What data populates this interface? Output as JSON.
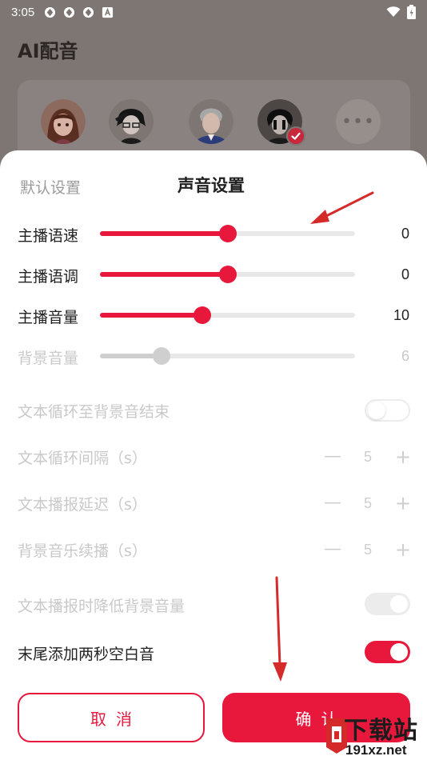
{
  "status_bar": {
    "time": "3:05",
    "notification_icons": [
      "app-icon",
      "app-icon",
      "app-icon",
      "a-icon"
    ]
  },
  "background": {
    "title": "AI配音"
  },
  "sheet": {
    "default_tab": "默认设置",
    "title": "声音设置",
    "sliders": [
      {
        "label": "主播语速",
        "value": "0",
        "level": 0.5,
        "enabled": true
      },
      {
        "label": "主播语调",
        "value": "0",
        "level": 0.5,
        "enabled": true
      },
      {
        "label": "主播音量",
        "value": "10",
        "level": 0.4,
        "enabled": true
      },
      {
        "label": "背景音量",
        "value": "6",
        "level": 0.24,
        "enabled": false
      }
    ],
    "loop_to_bg_end": {
      "label": "文本循环至背景音结束",
      "state": "off",
      "enabled": false
    },
    "steppers": [
      {
        "label": "文本循环间隔（s）",
        "value": "5",
        "minus": "—",
        "plus": "+"
      },
      {
        "label": "文本播报延迟（s）",
        "value": "5",
        "minus": "—",
        "plus": "+"
      },
      {
        "label": "背景音乐续播（s）",
        "value": "5",
        "minus": "—",
        "plus": "+"
      }
    ],
    "lower_bg_volume": {
      "label": "文本播报时降低背景音量",
      "state": "on",
      "enabled": false
    },
    "add_silence": {
      "label": "末尾添加两秒空白音",
      "state": "on",
      "enabled": true
    },
    "cancel_label": "取消",
    "confirm_label": "确认"
  },
  "watermark": {
    "top": "下载站",
    "bottom": "191xz.net"
  },
  "colors": {
    "accent": "#e8183d",
    "disabled": "#cfcfcf",
    "track": "#e8e8e8",
    "arrow": "#d42a2a"
  }
}
